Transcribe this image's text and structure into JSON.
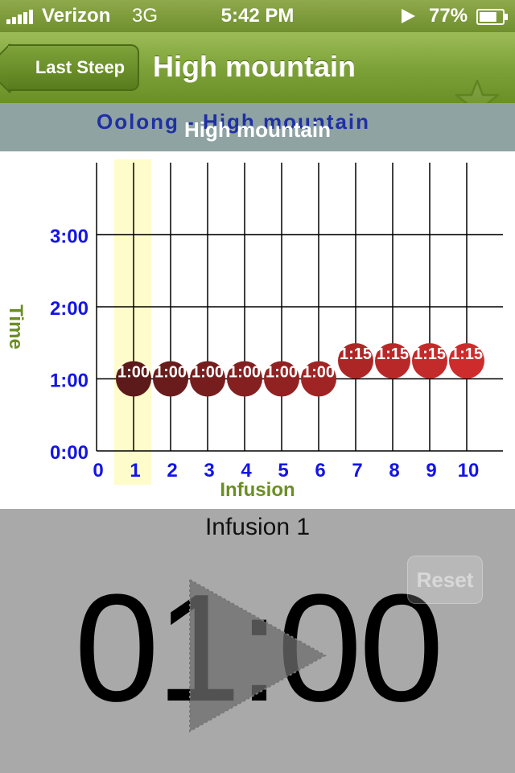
{
  "status_bar": {
    "carrier": "Verizon",
    "network": "3G",
    "time": "5:42 PM",
    "battery": "77%",
    "battery_level": 0.77,
    "icons": [
      "signal-bars-icon",
      "location-arrow-icon",
      "battery-icon"
    ]
  },
  "navbar": {
    "back_label": "Last Steep",
    "title": "High mountain",
    "favorite_icon": "star-outline-icon"
  },
  "tea": {
    "category_line": "Oolong - High mountain",
    "name": "High mountain"
  },
  "chart_data": {
    "type": "scatter",
    "xlabel": "Infusion",
    "ylabel": "Time",
    "x_ticks": [
      "0",
      "1",
      "2",
      "3",
      "4",
      "5",
      "6",
      "7",
      "8",
      "9",
      "10"
    ],
    "y_ticks": [
      "0:00",
      "1:00",
      "2:00",
      "3:00"
    ],
    "xlim": [
      0,
      10.5
    ],
    "ylim": [
      0,
      4
    ],
    "y_unit": "minutes",
    "grid": true,
    "highlighted_infusion": 1,
    "x": [
      1,
      2,
      3,
      4,
      5,
      6,
      7,
      8,
      9,
      10
    ],
    "y": [
      1,
      1,
      1,
      1,
      1,
      1,
      1.25,
      1.25,
      1.25,
      1.25
    ],
    "point_labels": [
      "1:00",
      "1:00",
      "1:00",
      "1:00",
      "1:00",
      "1:00",
      "1:15",
      "1:15",
      "1:15",
      "1:15"
    ],
    "point_colors": [
      "#5c1a1a",
      "#6a1c1c",
      "#761e1e",
      "#842020",
      "#922222",
      "#a02424",
      "#ad2626",
      "#b82828",
      "#c32a2a",
      "#ce2c2c"
    ],
    "colors": {
      "axis_tick_labels": "#1414e6",
      "axis_titles": "#6b8e23",
      "highlight": "#fffccc"
    }
  },
  "timer": {
    "infusion_label": "Infusion 1",
    "time": "01:00",
    "reset_label": "Reset",
    "play_icon": "play-icon"
  }
}
